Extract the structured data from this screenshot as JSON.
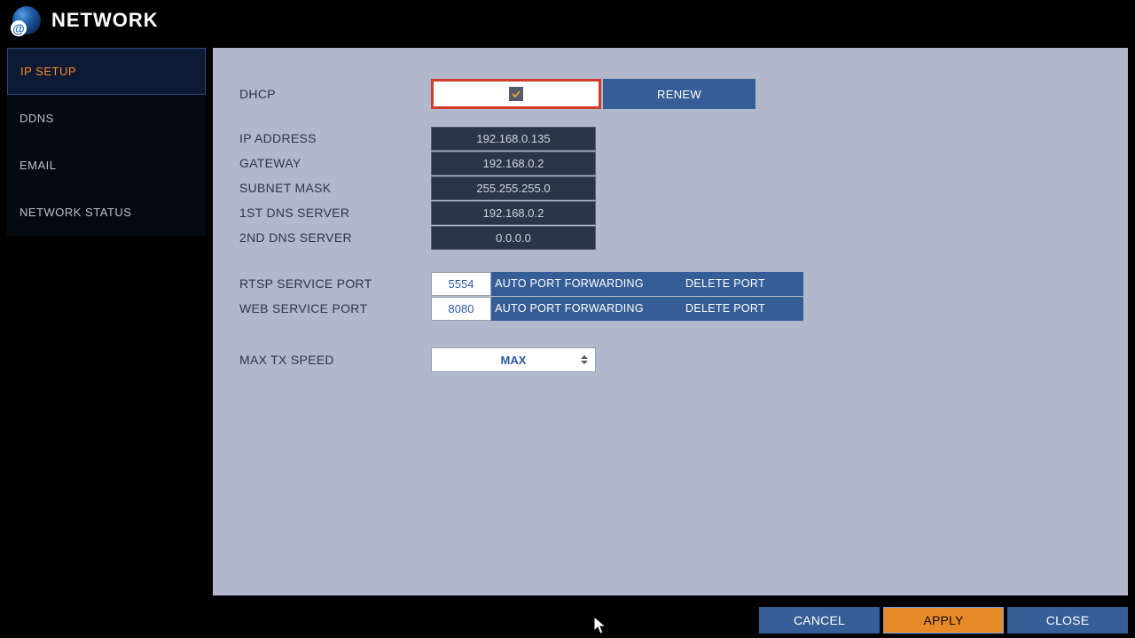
{
  "header": {
    "title": "NETWORK"
  },
  "sidebar": {
    "items": [
      {
        "label": "IP SETUP",
        "active": true
      },
      {
        "label": "DDNS",
        "active": false
      },
      {
        "label": "EMAIL",
        "active": false
      },
      {
        "label": "NETWORK STATUS",
        "active": false
      }
    ]
  },
  "labels": {
    "dhcp": "DHCP",
    "ip_address": "IP ADDRESS",
    "gateway": "GATEWAY",
    "subnet_mask": "SUBNET MASK",
    "dns1": "1ST DNS SERVER",
    "dns2": "2ND DNS SERVER",
    "rtsp_port": "RTSP SERVICE PORT",
    "web_port": "WEB SERVICE PORT",
    "max_tx": "MAX TX SPEED"
  },
  "values": {
    "dhcp_checked": true,
    "ip_address": "192.168.0.135",
    "gateway": "192.168.0.2",
    "subnet_mask": "255.255.255.0",
    "dns1": "192.168.0.2",
    "dns2": "0.0.0.0",
    "rtsp_port": "5554",
    "web_port": "8080",
    "max_tx": "MAX"
  },
  "buttons": {
    "renew": "RENEW",
    "auto_port": "AUTO PORT FORWARDING",
    "delete_port": "DELETE PORT",
    "cancel": "CANCEL",
    "apply": "APPLY",
    "close": "CLOSE"
  },
  "colors": {
    "accent_orange": "#e98a2a",
    "accent_blue": "#365e96",
    "panel_bg": "#b1b8cb",
    "highlight_red": "#d23a2a"
  }
}
